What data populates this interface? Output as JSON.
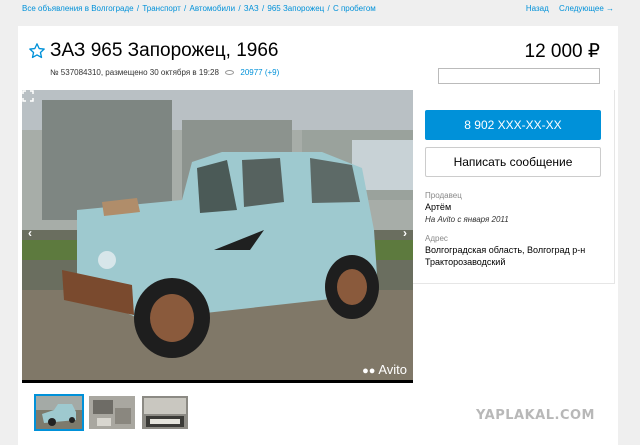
{
  "breadcrumb": {
    "items": [
      "Все объявления в Волгограде",
      "Транспорт",
      "Автомобили",
      "ЗАЗ",
      "965 Запорожец",
      "С пробегом"
    ],
    "separator": "/"
  },
  "nav": {
    "back": "Назад",
    "next": "Следующее →"
  },
  "listing": {
    "title": "ЗАЗ 965 Запорожец, 1966",
    "meta": "№ 537084310, размещено 30 октября в 19:28",
    "views": "20977 (+9)",
    "price": "12 000 ₽"
  },
  "photo": {
    "watermark": "Avito",
    "prev_arrow": "‹",
    "next_arrow": "›"
  },
  "contact": {
    "phone_button": "8 902 XXX-XX-XX",
    "message_button": "Написать сообщение"
  },
  "seller": {
    "label": "Продавец",
    "name": "Артём",
    "since": "На Avito с января 2011"
  },
  "address": {
    "label": "Адрес",
    "line1": "Волгоградская область, Волгоград р-н",
    "line2": "Тракторозаводский"
  },
  "site_watermark": "YAPLAKAL.COM",
  "colors": {
    "accent": "#0091d9",
    "car": "#9ec9cf"
  }
}
